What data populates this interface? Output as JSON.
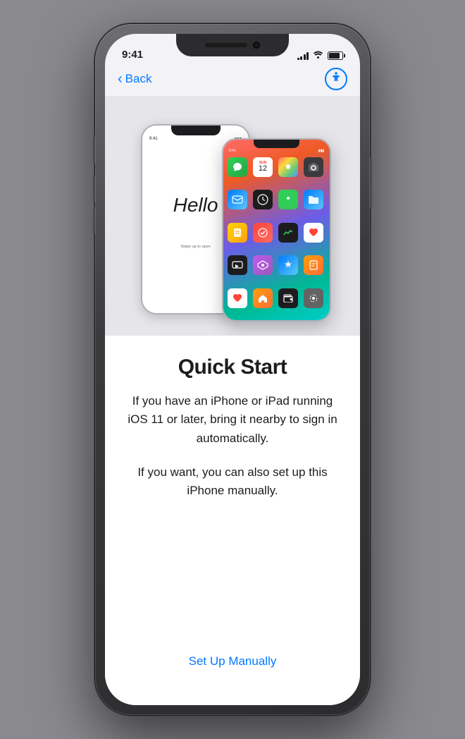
{
  "phone": {
    "status_time": "9:41",
    "nav": {
      "back_label": "Back",
      "accessibility_label": "Accessibility"
    },
    "image": {
      "phone_back": {
        "hello_text": "Hello",
        "swipe_text": "Swipe up to open"
      },
      "phone_front": {
        "time": "9:41",
        "calendar_day": "12",
        "apps": [
          "Messages",
          "Calendar",
          "Photos",
          "Camera",
          "Mail",
          "Clock",
          "Maps",
          "Files",
          "Notes",
          "Reminders",
          "Stocks",
          "Health",
          "TV",
          "Arcade",
          "App Store",
          "Books",
          "Health",
          "Home",
          "Wallet",
          "Settings"
        ]
      }
    },
    "content": {
      "title": "Quick Start",
      "description1": "If you have an iPhone or iPad running iOS 11 or later, bring it nearby to sign in automatically.",
      "description2": "If you want, you can also set up this iPhone manually.",
      "setup_manually": "Set Up Manually"
    }
  }
}
